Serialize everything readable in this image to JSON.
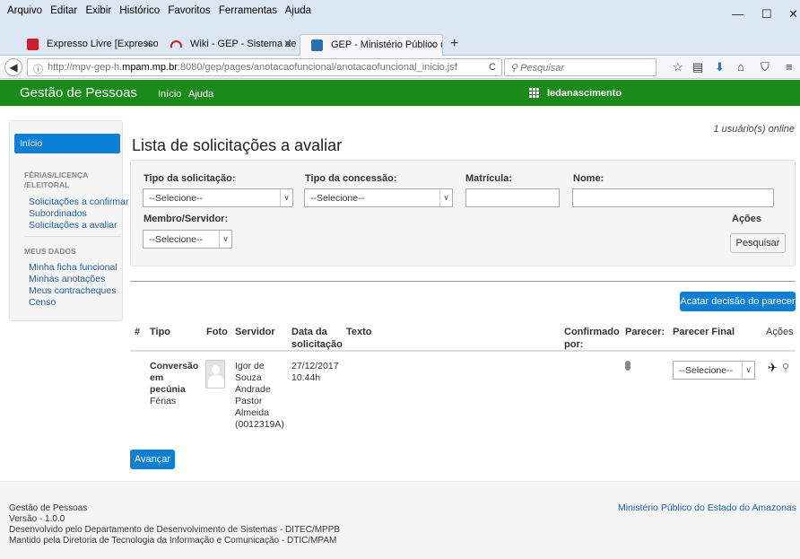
{
  "browser": {
    "menu": [
      "Arquivo",
      "Editar",
      "Exibir",
      "Histórico",
      "Favoritos",
      "Ferramentas",
      "Ajuda"
    ],
    "window_controls": {
      "minimize": "—",
      "maximize": "☐",
      "close": "✕"
    },
    "tabs": [
      {
        "label": "Expresso Livre [Expresso M...",
        "icon_color": "#c8202f",
        "active": false
      },
      {
        "label": "Wiki - GEP - Sistema de G...",
        "icon_color": "#c8202f",
        "active": false
      },
      {
        "label": "GEP - Ministério Público d...",
        "icon_color": "#2a6fb0",
        "active": true
      }
    ],
    "tab_close": "✕",
    "new_tab": "+",
    "url_prefix": "http://mpv-gep-h.",
    "url_host": "mpam.mp.br",
    "url_suffix": ":8080/gep/pages/anotacaofuncional/anotacaofuncional_inicio.jsf",
    "search_placeholder": "Pesquisar",
    "reload_glyph": "C",
    "toolbar_icons": {
      "bookmark_star": "☆",
      "reading_list": "▤",
      "download": "⬇",
      "home": "⌂",
      "pocket": "⛉",
      "menu": "≡"
    }
  },
  "app": {
    "brand": "Gestão de Pessoas",
    "nav": [
      "Início",
      "Ajuda"
    ],
    "user": "ledanascimento",
    "accent": "#1a8a1a",
    "primary": "#0e7fd6"
  },
  "online_users": "1 usuário(s) online",
  "sidebar": {
    "active": "Início",
    "section1_head_a": "FÉRIAS/LICENÇA",
    "section1_head_b": "/ELEITORAL",
    "section1": [
      "Solicitações a confirmar",
      "Subordinados",
      "Solicitações a avaliar"
    ],
    "section2_head": "MEUS DADOS",
    "section2": [
      "Minha ficha funcional",
      "Minhas anotações",
      "Meus contracheques",
      "Censo"
    ]
  },
  "page_title": "Lista de solicitações a avaliar",
  "filters": {
    "tipo_solicitacao": {
      "label": "Tipo da solicitação:",
      "value": "--Selecione--"
    },
    "tipo_concessao": {
      "label": "Tipo da concessão:",
      "value": "--Selecione--"
    },
    "matricula": {
      "label": "Matrícula:"
    },
    "nome": {
      "label": "Nome:"
    },
    "membro": {
      "label": "Membro/Servidor:",
      "value": "--Selecione--"
    },
    "acoes_label": "Ações",
    "search_button": "Pesquisar"
  },
  "acatar_button": "Acatar decisão do parecer",
  "table": {
    "headers": {
      "hash": "#",
      "tipo": "Tipo",
      "foto": "Foto",
      "servidor": "Servidor",
      "data_a": "Data da",
      "data_b": "solicitação",
      "texto": "Texto",
      "confirmado_a": "Confirmado",
      "confirmado_b": "por:",
      "parecer": "Parecer:",
      "parecer_final": "Parecer Final",
      "acoes": "Ações"
    },
    "rows": [
      {
        "tipo_lines": [
          "Conversão",
          "em",
          "pecúnia"
        ],
        "subtipo": "Férias",
        "servidor_lines": [
          "Igor de",
          "Souza",
          "Andrade",
          "Pastor",
          "Almeida",
          "(0012319A)"
        ],
        "data_lines": [
          "27/12/2017",
          "10:44h"
        ],
        "parecer_final": "--Selecione--",
        "action_icons": {
          "send": "✈",
          "view": "⚲"
        }
      }
    ]
  },
  "avancar_button": "Avançar",
  "footer": {
    "lines": [
      "Gestão de Pessoas",
      "Versão - 1.0.0",
      "Desenvolvido pelo Departamento de Desenvolvimento de Sistemas - DITEC/MPPB",
      "Mantido pela Diretoria de Tecnologia da Informação e Comunicação - DTIC/MPAM"
    ],
    "right": "Ministério Público do Estado do Amazonas"
  }
}
